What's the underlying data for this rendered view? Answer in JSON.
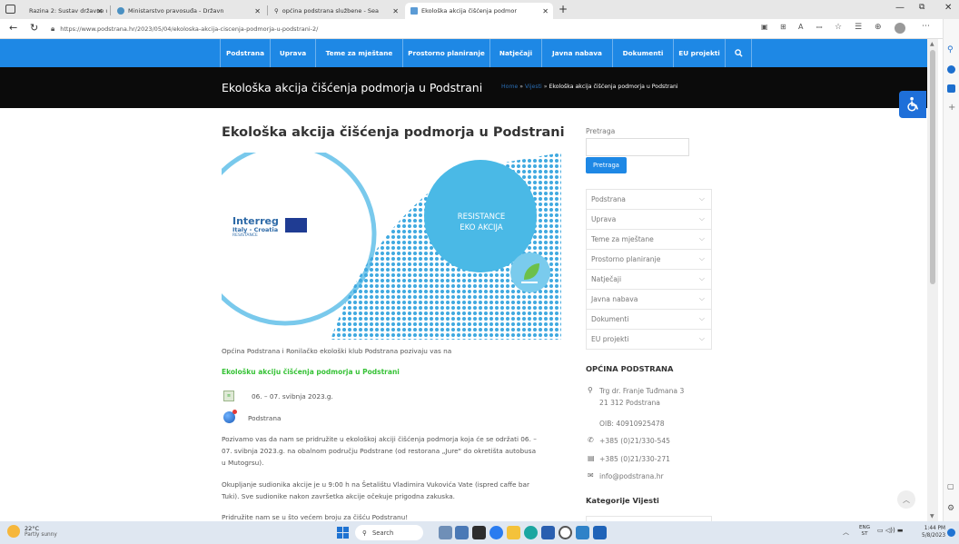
{
  "browser": {
    "tabs": [
      {
        "label": "Razina 2: Sustav državne uprave"
      },
      {
        "label": "Ministarstvo pravosuđa - Državn"
      },
      {
        "label": "općina podstrana službene - Sea"
      },
      {
        "label": "Ekološka akcija čišćenja podmor"
      }
    ],
    "url": "https://www.podstrana.hr/2023/05/04/ekoloska-akcija-ciscenja-podmorja-u-podstrani-2/",
    "url_host": "https://www.podstrana.hr"
  },
  "site": {
    "nav": [
      "Podstrana",
      "Uprava",
      "Teme za mještane",
      "Prostorno planiranje",
      "Natječaji",
      "Javna nabava",
      "Dokumenti",
      "EU projekti"
    ],
    "band_title": "Ekološka akcija čišćenja podmorja u Podstrani",
    "breadcrumb": {
      "home": "Home",
      "sep": "»",
      "news": "Vijesti",
      "current": "Ekološka akcija čišćenja podmorja u Podstrani"
    }
  },
  "article": {
    "title": "Ekološka akcija čišćenja podmorja u Podstrani",
    "image": {
      "brand1": "Interreg",
      "brand2": "Italy - Croatia",
      "brand3": "RESISTANCE",
      "circle_line1": "RESISTANCE",
      "circle_line2": "EKO AKCIJA"
    },
    "intro": "Općina Podstrana i Ronilačko ekološki klub Podstrana pozivaju vas na",
    "highlight": "Ekološku akciju čišćenja podmorja u Podstrani",
    "date": "06. – 07. svibnja 2023.g.",
    "location": "Podstrana",
    "para1_l1": "Pozivamo vas da nam se pridružite u ekološkoj akciji čišćenja podmorja koja će se održati 06. –",
    "para1_l2": "07. svibnja 2023.g. na obalnom području Podstrane (od restorana „Jure\" do okretišta autobusa",
    "para1_l3": "u Mutogrsu).",
    "para2_l1": "Okupljanje sudionika akcije je u 9:00 h na Šetalištu Vladimira Vukovića Vate (ispred caffe bar",
    "para2_l2": "Tuki). Sve sudionike nakon završetka akcije očekuje prigodna zakuska.",
    "para3": "Pridružite nam se u što većem broju za čišću Podstranu!"
  },
  "sidebar": {
    "search_label": "Pretraga",
    "search_button": "Pretraga",
    "menu": [
      "Podstrana",
      "Uprava",
      "Teme za mještane",
      "Prostorno planiranje",
      "Natječaji",
      "Javna nabava",
      "Dokumenti",
      "EU projekti"
    ],
    "org_title": "OPĆINA PODSTRANA",
    "address1": "Trg dr. Franje Tuđmana 3",
    "address2": "21 312 Podstrana",
    "oib": "OIB: 40910925478",
    "phone": "+385 (0)21/330-545",
    "fax": "+385 (0)21/330-271",
    "email": "info@podstrana.hr",
    "categories_title": "Kategorije Vijesti"
  },
  "taskbar": {
    "weather_temp": "22°C",
    "weather_desc": "Partly sunny",
    "search": "Search",
    "lang1": "ENG",
    "lang2": "ST",
    "time": "1:44 PM",
    "date": "5/8/2023"
  },
  "colors": {
    "nav_blue": "#1e88e5",
    "green_link": "#36c236",
    "band_black": "#0b0b0b"
  }
}
